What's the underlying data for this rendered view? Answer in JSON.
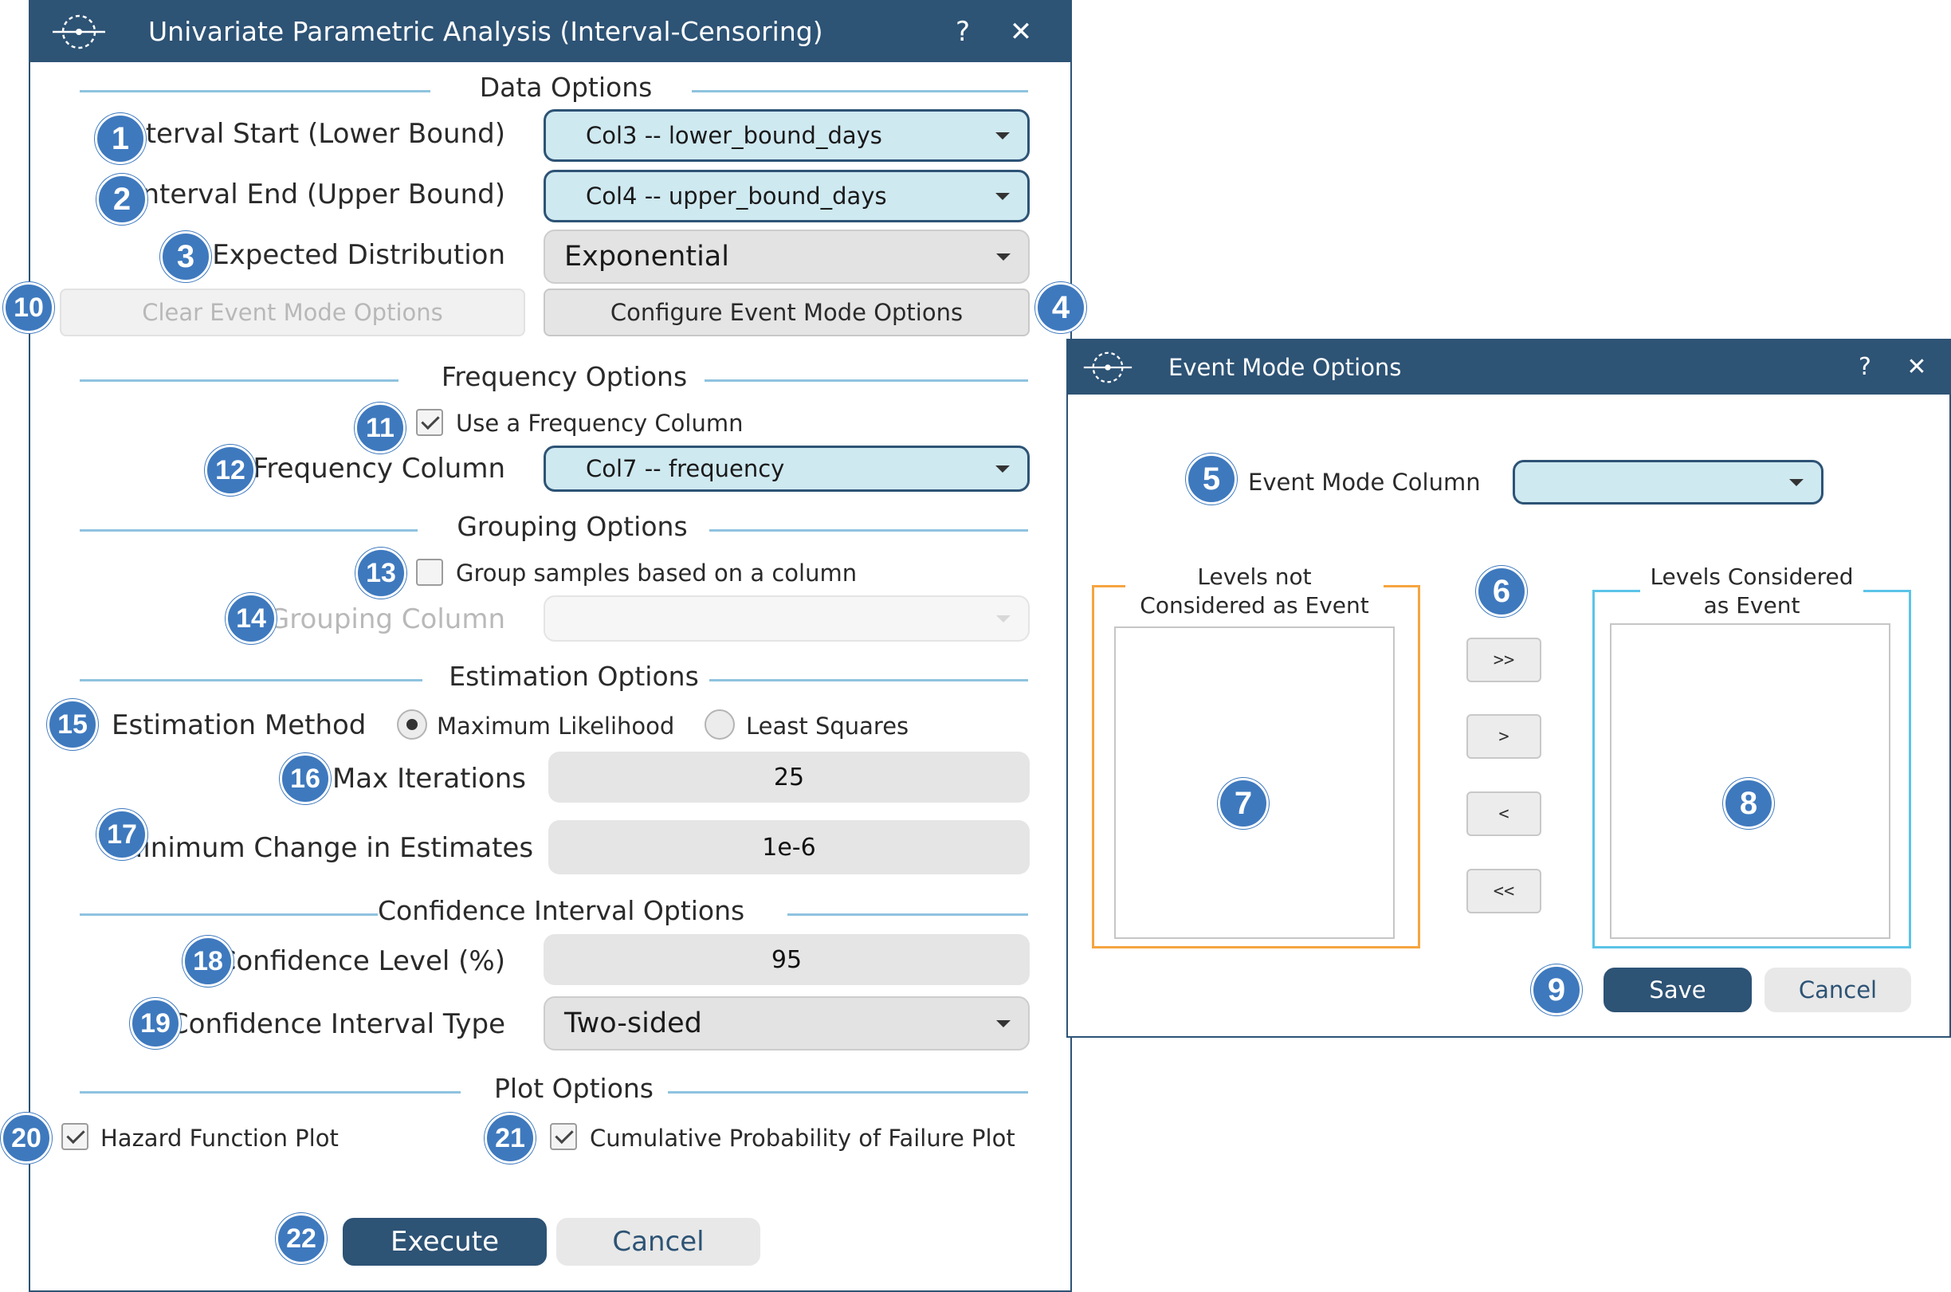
{
  "main_window": {
    "title": "Univariate Parametric Analysis (Interval-Censoring)",
    "help": "?",
    "close": "✕",
    "data_options": {
      "section_title": "Data Options",
      "interval_start_label": "Interval Start (Lower Bound)",
      "interval_start_value": "Col3 -- lower_bound_days",
      "interval_end_label": "Interval End (Upper Bound)",
      "interval_end_value": "Col4 -- upper_bound_days",
      "distribution_label": "Expected Distribution",
      "distribution_value": "Exponential",
      "clear_event_mode_label": "Clear Event Mode Options",
      "configure_event_mode_label": "Configure Event Mode Options"
    },
    "frequency_options": {
      "section_title": "Frequency Options",
      "use_frequency_label": "Use a Frequency Column",
      "frequency_column_label": "Frequency Column",
      "frequency_column_value": "Col7 -- frequency"
    },
    "grouping_options": {
      "section_title": "Grouping Options",
      "group_samples_label": "Group samples based on a column",
      "grouping_column_label": "Grouping Column",
      "grouping_column_value": ""
    },
    "estimation_options": {
      "section_title": "Estimation Options",
      "method_label": "Estimation Method",
      "max_likelihood_label": "Maximum Likelihood",
      "least_squares_label": "Least Squares",
      "max_iterations_label": "Max Iterations",
      "max_iterations_value": "25",
      "min_change_label": "Minimum Change in Estimates",
      "min_change_value": "1e-6"
    },
    "ci_options": {
      "section_title": "Confidence Interval Options",
      "confidence_level_label": "Confidence Level (%)",
      "confidence_level_value": "95",
      "ci_type_label": "Confidence Interval Type",
      "ci_type_value": "Two-sided"
    },
    "plot_options": {
      "section_title": "Plot Options",
      "hazard_label": "Hazard Function Plot",
      "cumulative_label": "Cumulative Probability of Failure Plot"
    },
    "execute_label": "Execute",
    "cancel_label": "Cancel"
  },
  "event_window": {
    "title": "Event Mode Options",
    "help": "?",
    "close": "✕",
    "event_mode_column_label": "Event Mode Column",
    "event_mode_column_value": "",
    "levels_not_title_line1": "Levels not",
    "levels_not_title_line2": "Considered as Event",
    "levels_considered_title_line1": "Levels Considered",
    "levels_considered_title_line2": "as Event",
    "move_all_right": ">>",
    "move_right": ">",
    "move_left": "<",
    "move_all_left": "<<",
    "save_label": "Save",
    "cancel_label": "Cancel"
  },
  "badges": [
    "1",
    "2",
    "3",
    "4",
    "5",
    "6",
    "7",
    "8",
    "9",
    "10",
    "11",
    "12",
    "13",
    "14",
    "15",
    "16",
    "17",
    "18",
    "19",
    "20",
    "21",
    "22"
  ],
  "colors": {
    "titlebar": "#2d5375",
    "combo_highlight": "#cfe9f1",
    "section_line": "#8fc3df",
    "badge": "#3e79be",
    "frame_left": "#f5a540",
    "frame_right": "#5bc4e8"
  },
  "icons": {
    "logo": "app-logo-icon",
    "help": "help-icon",
    "close": "close-icon",
    "dropdown": "chevron-down-icon"
  }
}
